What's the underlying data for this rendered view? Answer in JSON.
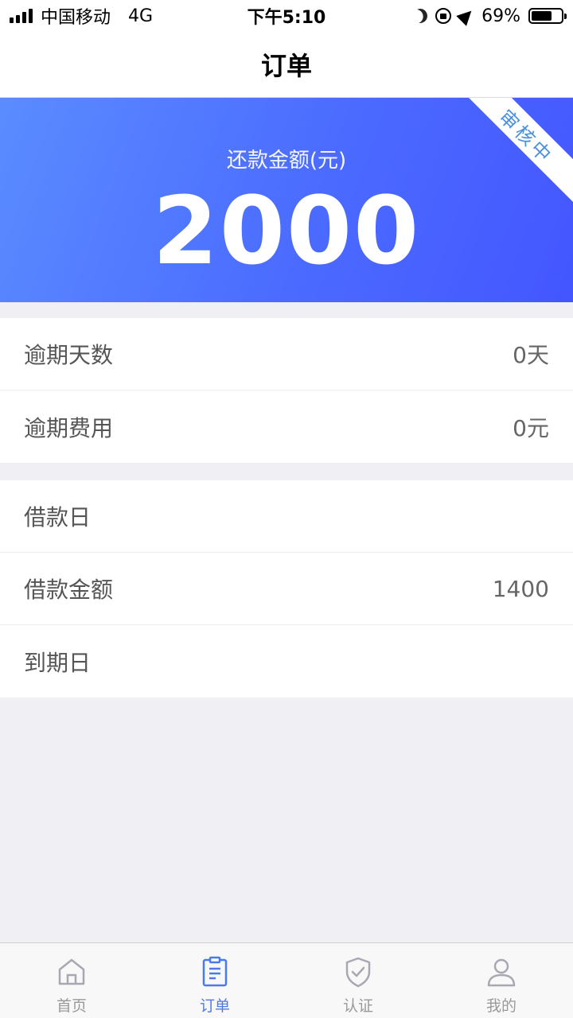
{
  "status_bar": {
    "carrier": "中国移动",
    "network": "4G",
    "time": "下午5:10",
    "battery": "69%",
    "battery_level": 0.69
  },
  "nav": {
    "title": "订单"
  },
  "hero": {
    "label": "还款金额(元)",
    "amount": "2000",
    "ribbon": "审核中"
  },
  "section1": [
    {
      "label": "逾期天数",
      "value": "0天"
    },
    {
      "label": "逾期费用",
      "value": "0元"
    }
  ],
  "section2": [
    {
      "label": "借款日",
      "value": ""
    },
    {
      "label": "借款金额",
      "value": "1400"
    },
    {
      "label": "到期日",
      "value": ""
    }
  ],
  "tabs": [
    {
      "label": "首页",
      "icon": "home-icon",
      "active": false
    },
    {
      "label": "订单",
      "icon": "clipboard-icon",
      "active": true
    },
    {
      "label": "认证",
      "icon": "shield-check-icon",
      "active": false
    },
    {
      "label": "我的",
      "icon": "user-icon",
      "active": false
    }
  ],
  "colors": {
    "accent": "#4a7be8",
    "hero_start": "#5a8cff",
    "hero_end": "#4456ff",
    "ribbon_text": "#4a90e2",
    "tab_inactive": "#999999"
  }
}
